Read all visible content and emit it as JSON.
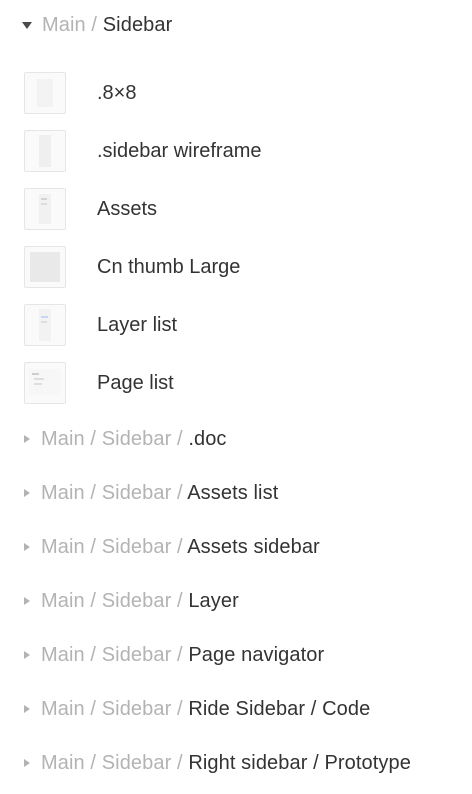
{
  "expanded_group": {
    "path_parts": [
      "Main",
      "Sidebar"
    ],
    "separator": " / "
  },
  "components": [
    {
      "label": ".8×8",
      "thumb": "blank"
    },
    {
      "label": ".sidebar wireframe",
      "thumb": "column"
    },
    {
      "label": "Assets",
      "thumb": "assets"
    },
    {
      "label": "Cn thumb Large",
      "thumb": "filled"
    },
    {
      "label": "Layer list",
      "thumb": "layer"
    },
    {
      "label": "Page list",
      "thumb": "pages"
    }
  ],
  "collapsed_groups": [
    {
      "muted": "Main / Sidebar / ",
      "name": ".doc"
    },
    {
      "muted": "Main / Sidebar / ",
      "name": "Assets list"
    },
    {
      "muted": "Main / Sidebar / ",
      "name": "Assets sidebar"
    },
    {
      "muted": "Main / Sidebar / ",
      "name": "Layer"
    },
    {
      "muted": "Main / Sidebar / ",
      "name": "Page navigator"
    },
    {
      "muted": "Main / Sidebar / ",
      "name": "Ride Sidebar / Code"
    },
    {
      "muted": "Main / Sidebar / ",
      "name": "Right sidebar / Prototype"
    }
  ],
  "colors": {
    "muted_text": "#b3b3b3",
    "primary_text": "#333333",
    "thumb_border": "#e6e6e6"
  }
}
